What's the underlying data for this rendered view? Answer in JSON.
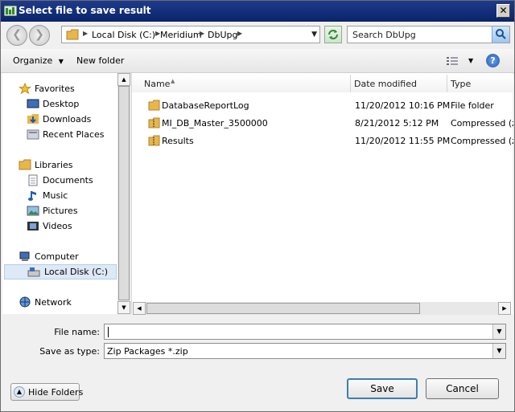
{
  "window": {
    "title": "Select file to save result"
  },
  "nav": {
    "back_glyph": "❮",
    "forward_glyph": "❯"
  },
  "address": {
    "crumbs": [
      "Local Disk (C:)",
      "Meridium",
      "DbUpg"
    ]
  },
  "search": {
    "placeholder": "Search DbUpg"
  },
  "toolbar": {
    "organize": "Organize",
    "new_folder": "New folder",
    "help": "?"
  },
  "navpane": {
    "favorites": "Favorites",
    "desktop": "Desktop",
    "downloads": "Downloads",
    "recent_places": "Recent Places",
    "libraries": "Libraries",
    "documents": "Documents",
    "music": "Music",
    "pictures": "Pictures",
    "videos": "Videos",
    "computer": "Computer",
    "local_disk": "Local Disk (C:)",
    "network": "Network"
  },
  "columns": {
    "name": "Name",
    "date_modified": "Date modified",
    "type": "Type"
  },
  "files": [
    {
      "name": "DatabaseReportLog",
      "date": "11/20/2012 10:16 PM",
      "type": "File folder",
      "icon": "folder-icon"
    },
    {
      "name": "MI_DB_Master_3500000",
      "date": "8/21/2012 5:12 PM",
      "type": "Compressed (zip",
      "icon": "zip-folder-icon"
    },
    {
      "name": "Results",
      "date": "11/20/2012 11:55 PM",
      "type": "Compressed (zip",
      "icon": "zip-folder-icon"
    }
  ],
  "form": {
    "file_name_label": "File name:",
    "file_name_value": "",
    "save_as_type_label": "Save as type:",
    "save_as_type_value": "Zip Packages *.zip"
  },
  "buttons": {
    "hide_folders": "Hide Folders",
    "save": "Save",
    "cancel": "Cancel"
  },
  "colors": {
    "title_bar": "#0a246a",
    "selection": "#dde9f6",
    "folder": "#e8b64a"
  }
}
